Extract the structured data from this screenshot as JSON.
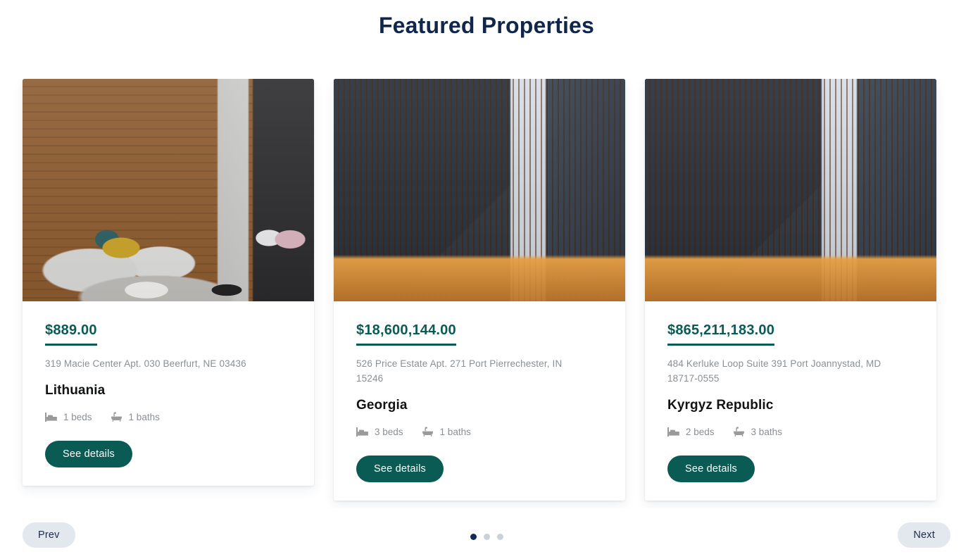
{
  "section": {
    "title": "Featured Properties"
  },
  "cards": [
    {
      "price": "$889.00",
      "address": "319 Macie Center Apt. 030 Beerfurt, NE 03436",
      "title": "Lithuania",
      "beds": "1 beds",
      "baths": "1 baths",
      "cta": "See details",
      "image_alt": "modern-living-room-interior"
    },
    {
      "price": "$18,600,144.00",
      "address": "526 Price Estate Apt. 271 Port Pierrechester, IN 15246",
      "title": "Georgia",
      "beds": "3 beds",
      "baths": "1 baths",
      "cta": "See details",
      "image_alt": "dark-modern-house-facade-dusk"
    },
    {
      "price": "$865,211,183.00",
      "address": "484 Kerluke Loop Suite 391 Port Joannystad, MD 18717-0555",
      "title": "Kyrgyz Republic",
      "beds": "2 beds",
      "baths": "3 baths",
      "cta": "See details",
      "image_alt": "dark-modern-house-facade-dusk"
    }
  ],
  "controls": {
    "prev_label": "Prev",
    "next_label": "Next",
    "dots": [
      {
        "active": true
      },
      {
        "active": false
      },
      {
        "active": false
      }
    ]
  },
  "icons": {
    "bed": "bed-icon",
    "bath": "bath-icon"
  },
  "colors": {
    "title": "#10264b",
    "price": "#0b5b55",
    "button": "#0b5b55",
    "nav_button_bg": "#e3e7ee",
    "nav_button_text": "#1b2c4f",
    "address_text": "#8a8f94",
    "dot_active": "#132c55",
    "dot_inactive": "#ccd1d9",
    "page_bg": "#ffffff"
  }
}
